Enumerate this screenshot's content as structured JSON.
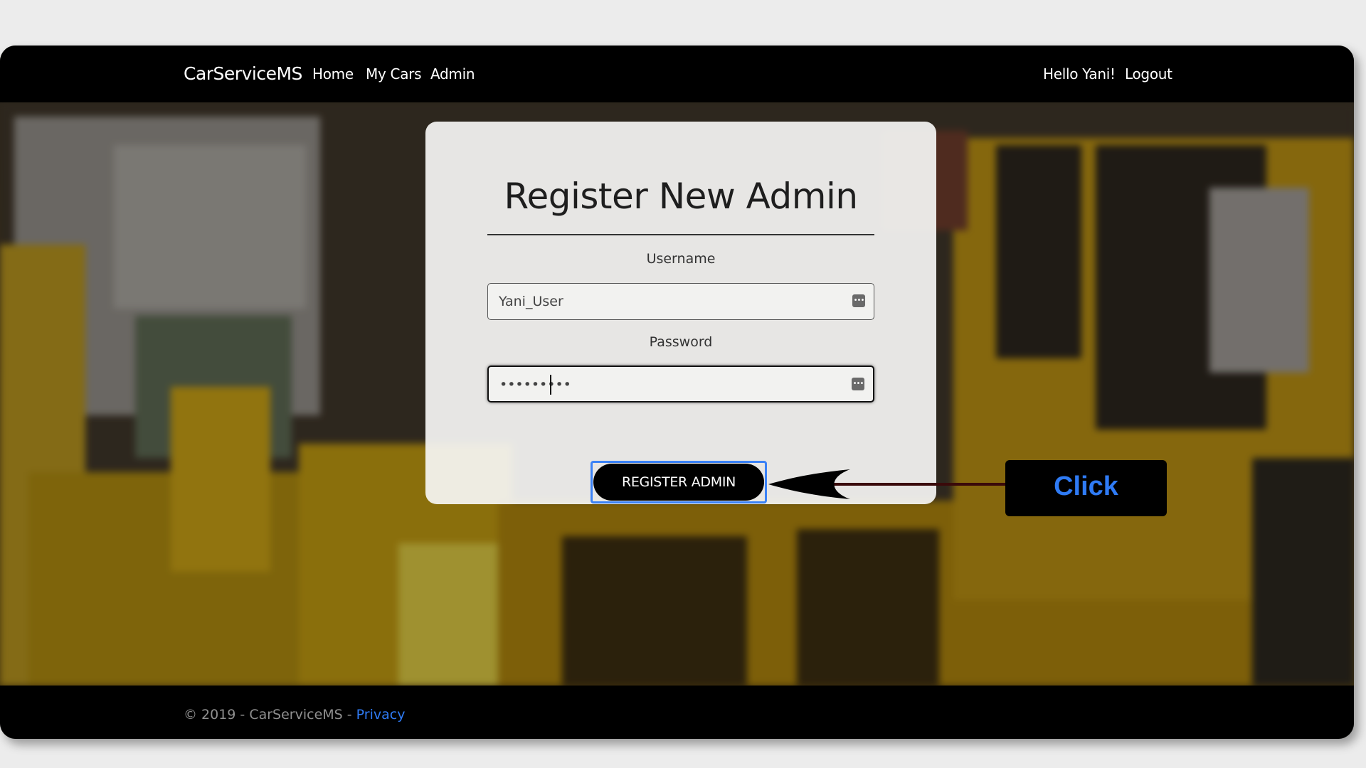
{
  "navbar": {
    "brand": "CarServiceMS",
    "links": [
      "Home",
      "My Cars",
      "Admin"
    ],
    "greeting": "Hello Yani!",
    "logout": "Logout"
  },
  "form": {
    "title": "Register New Admin",
    "username_label": "Username",
    "username_value": "Yani_User",
    "password_label": "Password",
    "password_value": "•••••••••",
    "submit_label": "REGISTER ADMIN"
  },
  "callout": {
    "text": "Click"
  },
  "footer": {
    "text": "© 2019 - CarServiceMS - ",
    "privacy": "Privacy"
  },
  "colors": {
    "accent": "#2f7bf5",
    "focus_outline": "#3b82f6"
  },
  "icons": {
    "field_icon": "password-manager-icon"
  }
}
